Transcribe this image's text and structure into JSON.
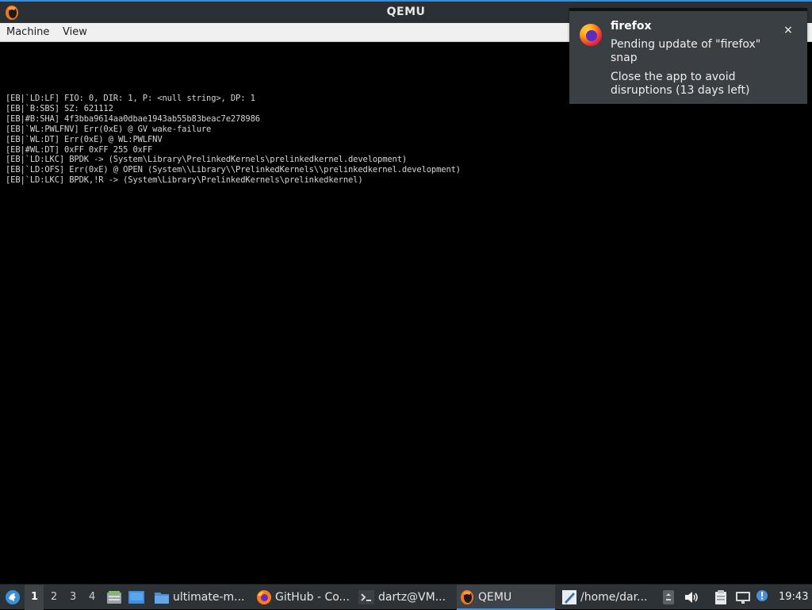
{
  "window": {
    "title": "QEMU"
  },
  "menubar": {
    "items": [
      {
        "label": "Machine"
      },
      {
        "label": "View"
      }
    ]
  },
  "console": {
    "lines": [
      "[EB|`LD:LF] FIO: 0, DIR: 1, P: <null string>, DP: 1",
      "[EB|`B:SBS] SZ: 621112",
      "[EB|#B:SHA] 4f3bba9614aa0dbae1943ab55b83beac7e278986",
      "[EB|`WL:PWLFNV] Err(0xE) @ GV wake-failure",
      "[EB|`WL:DT] Err(0xE) @ WL:PWLFNV",
      "[EB|#WL:DT] 0xFF 0xFF 255 0xFF",
      "[EB|`LD:LKC] BPDK -> (System\\Library\\PrelinkedKernels\\prelinkedkernel.development)",
      "[EB|`LD:OFS] Err(0xE) @ OPEN (System\\\\Library\\\\PrelinkedKernels\\\\prelinkedkernel.development)",
      "[EB|`LD:LKC] BPDK,!R -> (System\\Library\\PrelinkedKernels\\prelinkedkernel)"
    ]
  },
  "notification": {
    "app": "firefox",
    "body": "Pending update of \"firefox\" snap",
    "detail": "Close the app to avoid disruptions (13 days left)",
    "close": "×",
    "icon": "firefox-icon"
  },
  "taskbar": {
    "workspaces": [
      "1",
      "2",
      "3",
      "4"
    ],
    "active_workspace": "1",
    "tasks": [
      {
        "label": "ultimate-m...",
        "icon": "folder-icon"
      },
      {
        "label": "GitHub - Co...",
        "icon": "firefox-icon"
      },
      {
        "label": "dartz@VM...",
        "icon": "terminal-icon"
      },
      {
        "label": "QEMU",
        "icon": "qemu-icon",
        "active": true
      },
      {
        "label": "/home/dar...",
        "icon": "editor-icon"
      }
    ],
    "clock": "19:43"
  },
  "colors": {
    "titlebar": "#2b3034",
    "accent": "#3b8bd6",
    "console_bg": "#000000",
    "console_text": "#d6d6d6",
    "taskbar": "#2d3236",
    "notification_bg": "#3a3f44"
  }
}
